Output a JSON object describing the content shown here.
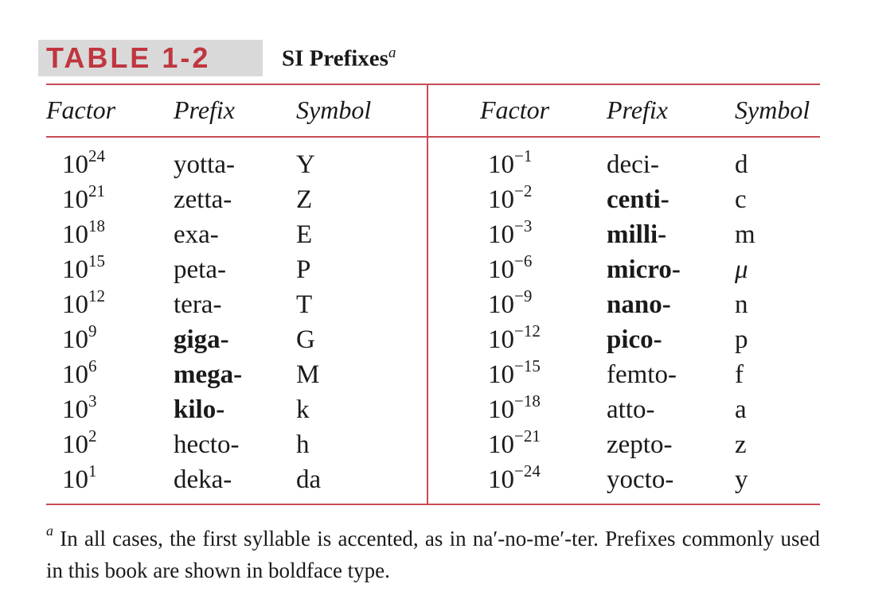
{
  "title": {
    "label": "TABLE 1-2",
    "text": "SI Prefixes",
    "footnote_marker": "a"
  },
  "headers": {
    "factor": "Factor",
    "prefix": "Prefix",
    "symbol": "Symbol"
  },
  "left_rows": [
    {
      "base": "10",
      "exp": "24",
      "prefix": "yotta-",
      "bold": false,
      "symbol": "Y"
    },
    {
      "base": "10",
      "exp": "21",
      "prefix": "zetta-",
      "bold": false,
      "symbol": "Z"
    },
    {
      "base": "10",
      "exp": "18",
      "prefix": "exa-",
      "bold": false,
      "symbol": "E"
    },
    {
      "base": "10",
      "exp": "15",
      "prefix": "peta-",
      "bold": false,
      "symbol": "P"
    },
    {
      "base": "10",
      "exp": "12",
      "prefix": "tera-",
      "bold": false,
      "symbol": "T"
    },
    {
      "base": "10",
      "exp": "9",
      "prefix": "giga-",
      "bold": true,
      "symbol": "G"
    },
    {
      "base": "10",
      "exp": "6",
      "prefix": "mega-",
      "bold": true,
      "symbol": "M"
    },
    {
      "base": "10",
      "exp": "3",
      "prefix": "kilo-",
      "bold": true,
      "symbol": "k"
    },
    {
      "base": "10",
      "exp": "2",
      "prefix": "hecto-",
      "bold": false,
      "symbol": "h"
    },
    {
      "base": "10",
      "exp": "1",
      "prefix": "deka-",
      "bold": false,
      "symbol": "da"
    }
  ],
  "right_rows": [
    {
      "base": "10",
      "exp": "−1",
      "prefix": "deci-",
      "bold": false,
      "symbol": "d"
    },
    {
      "base": "10",
      "exp": "−2",
      "prefix": "centi-",
      "bold": true,
      "symbol": "c"
    },
    {
      "base": "10",
      "exp": "−3",
      "prefix": "milli-",
      "bold": true,
      "symbol": "m"
    },
    {
      "base": "10",
      "exp": "−6",
      "prefix": "micro-",
      "bold": true,
      "symbol": "μ"
    },
    {
      "base": "10",
      "exp": "−9",
      "prefix": "nano-",
      "bold": true,
      "symbol": "n"
    },
    {
      "base": "10",
      "exp": "−12",
      "prefix": "pico-",
      "bold": true,
      "symbol": "p"
    },
    {
      "base": "10",
      "exp": "−15",
      "prefix": "femto-",
      "bold": false,
      "symbol": "f"
    },
    {
      "base": "10",
      "exp": "−18",
      "prefix": "atto-",
      "bold": false,
      "symbol": "a"
    },
    {
      "base": "10",
      "exp": "−21",
      "prefix": "zepto-",
      "bold": false,
      "symbol": "z"
    },
    {
      "base": "10",
      "exp": "−24",
      "prefix": "yocto-",
      "bold": false,
      "symbol": "y"
    }
  ],
  "footnote": {
    "marker": "a",
    "text": "In all cases, the first syllable is accented, as in na′-no-me′-ter. Prefixes commonly used in this book are shown in boldface type."
  },
  "colors": {
    "accent": "#c0363f",
    "rule": "#c94a55",
    "label_background": "#d9d9d9"
  }
}
